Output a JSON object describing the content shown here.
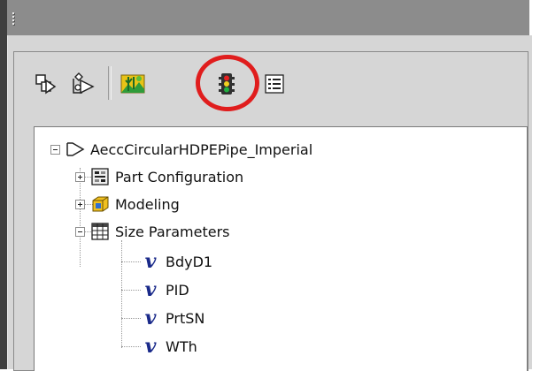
{
  "toolbar": {
    "buttons": [
      {
        "id": "btn1",
        "icon": "arrow-box-icon",
        "active": false
      },
      {
        "id": "btn2",
        "icon": "arrow-gear-icon",
        "active": false
      },
      {
        "id": "btn3",
        "icon": "tree-landscape-icon",
        "active": false
      },
      {
        "id": "btn4",
        "icon": "traffic-light-icon",
        "active": true
      },
      {
        "id": "btn5",
        "icon": "list-icon",
        "active": false
      }
    ],
    "highlight_color": "#e01d1d"
  },
  "tree": {
    "root": {
      "label": "AeccCircularHDPEPipe_Imperial",
      "expanded": true
    },
    "children": [
      {
        "label": "Part Configuration",
        "icon": "part-config-icon",
        "expanded": false
      },
      {
        "label": "Modeling",
        "icon": "modeling-cube-icon",
        "expanded": false
      },
      {
        "label": "Size Parameters",
        "icon": "grid-table-icon",
        "expanded": true
      }
    ],
    "size_parameters": [
      {
        "label": "BdyD1"
      },
      {
        "label": "PID"
      },
      {
        "label": "PrtSN"
      },
      {
        "label": "WTh"
      }
    ]
  },
  "colors": {
    "panel_bg": "#d6d6d6",
    "titlebar_bg": "#8c8c8c",
    "variable_icon": "#1a2a8a"
  }
}
